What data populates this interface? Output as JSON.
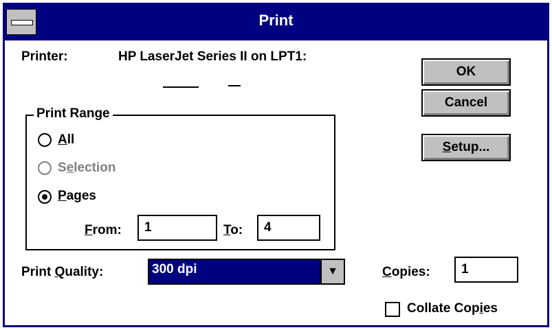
{
  "window": {
    "title": "Print"
  },
  "printer": {
    "label": "Printer:",
    "value": "HP LaserJet Series II on LPT1:"
  },
  "buttons": {
    "ok": "OK",
    "cancel": "Cancel",
    "setup": "Setup..."
  },
  "print_range": {
    "legend": "Print Range",
    "options": [
      {
        "label": "All",
        "selected": false,
        "enabled": true
      },
      {
        "label": "Selection",
        "selected": false,
        "enabled": false
      },
      {
        "label": "Pages",
        "selected": true,
        "enabled": true
      }
    ],
    "from_label": "From:",
    "from_value": "1",
    "to_label": "To:",
    "to_value": "4"
  },
  "print_quality": {
    "label": "Print Quality:",
    "value": "300 dpi"
  },
  "copies": {
    "label": "Copies:",
    "value": "1"
  },
  "collate": {
    "label": "Collate Copies",
    "checked": false
  },
  "colors": {
    "title_bar": "#000080",
    "button_face": "#c0c0c0"
  },
  "icons": {
    "system_menu": "system-menu-icon",
    "dropdown": "dropdown-arrow-icon"
  }
}
